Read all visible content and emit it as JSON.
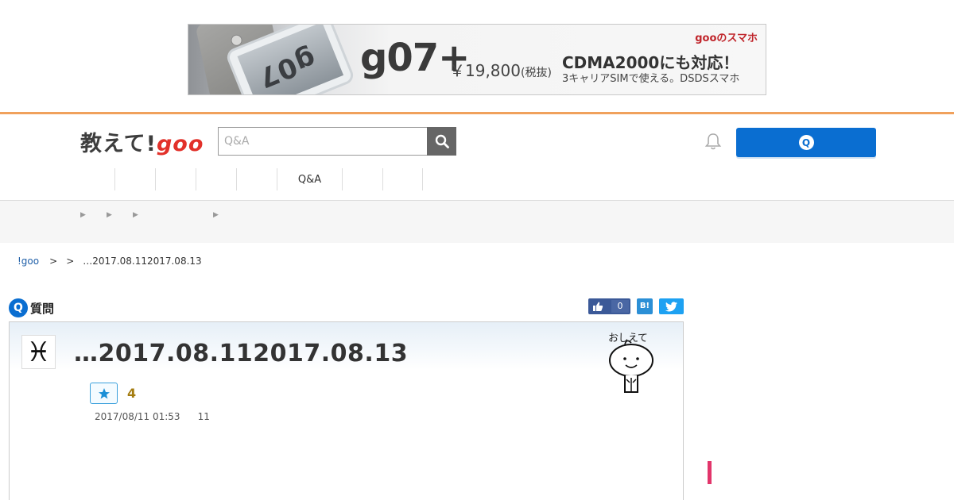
{
  "ad": {
    "product": "g07+",
    "price": "￥19,800",
    "price_tax": "(税抜)",
    "headline": "CDMA2000にも対応！",
    "sub": "3キャリアSIMで使える。DSDSスマホ",
    "brand_goo": "goo",
    "brand_suffix": "のスマホ",
    "phone_logo": "g07"
  },
  "header": {
    "logo_text": "教えて!",
    "logo_goo": "goo",
    "search_placeholder": "Q&A",
    "ask_icon": "Q",
    "icons": {
      "search": "search-icon",
      "bell": "bell-icon"
    },
    "accent_color": "#0a6ed1",
    "brand_red": "#e2312a",
    "line_color": "#f0a15c"
  },
  "nav": {
    "items": [
      "",
      "",
      "",
      "",
      "Q&A",
      "",
      ""
    ]
  },
  "breadcrumb": {
    "home": "!goo",
    "sep1": ">",
    "sep2": ">",
    "current": "…2017.08.112017.08.13"
  },
  "question": {
    "label_icon": "Q",
    "label": "質問",
    "title": "…2017.08.112017.08.13",
    "avatar_symbol": "♓",
    "mascot_text": "おしえて",
    "favorite_count": "4",
    "date": "2017/08/11 01:53",
    "views": "11"
  },
  "share": {
    "fb_count": "0",
    "hatena": "B!"
  }
}
